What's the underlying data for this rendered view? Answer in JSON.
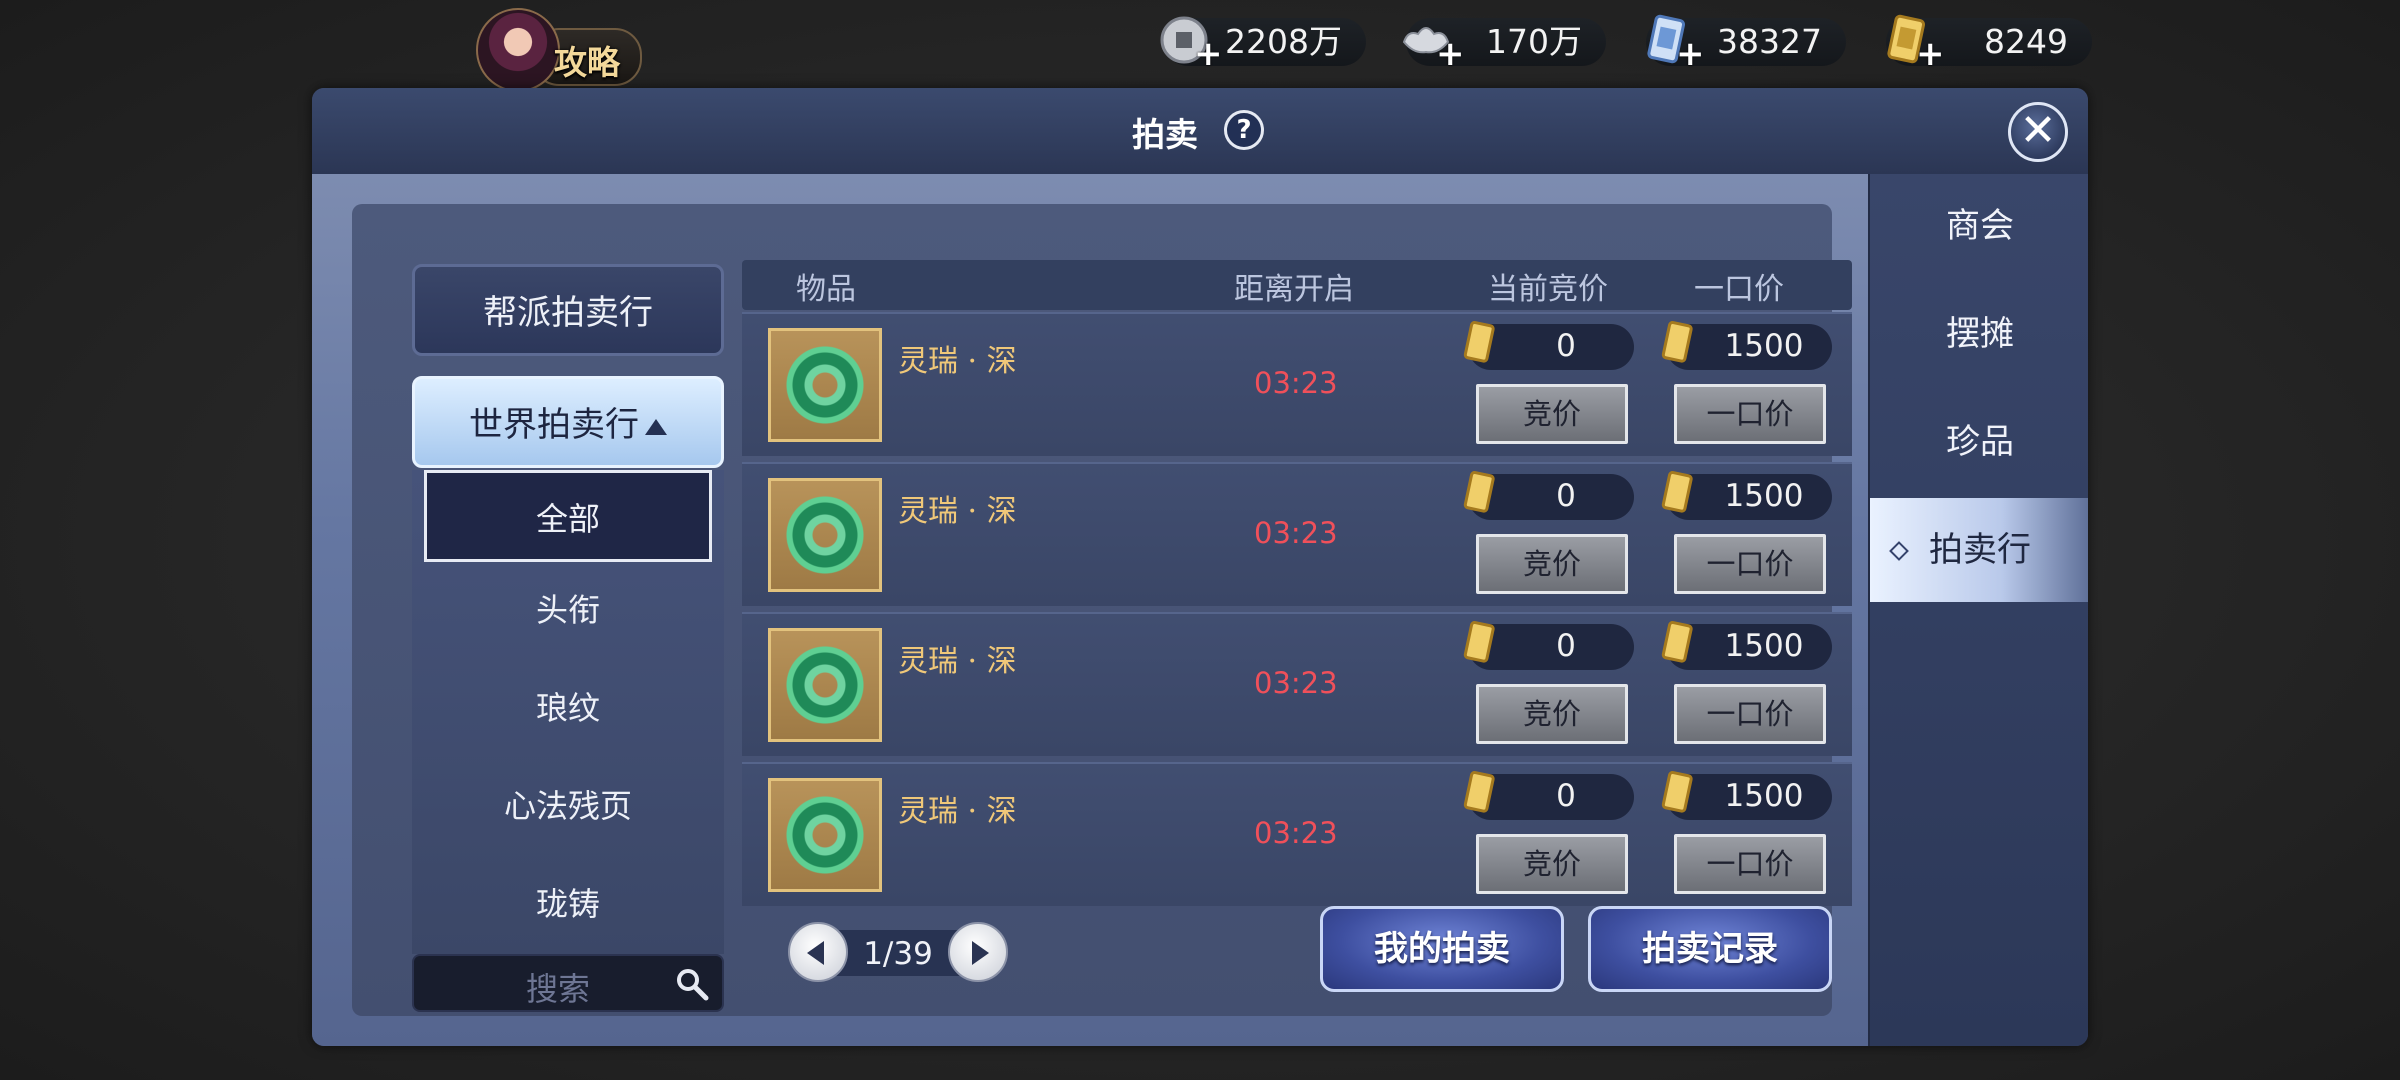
{
  "top_bar": {
    "guide_label": "攻略",
    "currencies": [
      {
        "icon": "copper-coin-icon",
        "value": "2208万"
      },
      {
        "icon": "silver-ingot-icon",
        "value": "170万"
      },
      {
        "icon": "blue-ticket-icon",
        "value": "38327"
      },
      {
        "icon": "gold-ticket-icon",
        "value": "8249"
      }
    ],
    "plus_symbol": "+"
  },
  "dialog": {
    "title": "拍卖",
    "help_symbol": "?",
    "close_symbol": "✕"
  },
  "right_tabs": [
    {
      "label": "商会",
      "active": false
    },
    {
      "label": "摆摊",
      "active": false
    },
    {
      "label": "珍品",
      "active": false
    },
    {
      "label": "拍卖行",
      "active": true
    }
  ],
  "categories": {
    "guild_auction": "帮派拍卖行",
    "world_auction": "世界拍卖行",
    "sub_items": [
      "全部",
      "头衔",
      "琅纹",
      "心法残页",
      "珑铸"
    ],
    "search_placeholder": "搜索"
  },
  "table": {
    "headers": {
      "item": "物品",
      "time_to_open": "距离开启",
      "current_bid": "当前竞价",
      "buyout": "一口价"
    },
    "rows": [
      {
        "name": "灵瑞 · 深",
        "timer": "03:23",
        "current_bid": "0",
        "buyout": "1500",
        "bid_label": "竞价",
        "buyout_label": "一口价"
      },
      {
        "name": "灵瑞 · 深",
        "timer": "03:23",
        "current_bid": "0",
        "buyout": "1500",
        "bid_label": "竞价",
        "buyout_label": "一口价"
      },
      {
        "name": "灵瑞 · 深",
        "timer": "03:23",
        "current_bid": "0",
        "buyout": "1500",
        "bid_label": "竞价",
        "buyout_label": "一口价"
      },
      {
        "name": "灵瑞 · 深",
        "timer": "03:23",
        "current_bid": "0",
        "buyout": "1500",
        "bid_label": "竞价",
        "buyout_label": "一口价"
      }
    ]
  },
  "pager": {
    "text": "1/39"
  },
  "bottom_buttons": {
    "my_auctions": "我的拍卖",
    "auction_records": "拍卖记录"
  },
  "colors": {
    "timer": "#f0505a",
    "item_name": "#f0c879",
    "accent_blue": "#3e4fa0"
  }
}
